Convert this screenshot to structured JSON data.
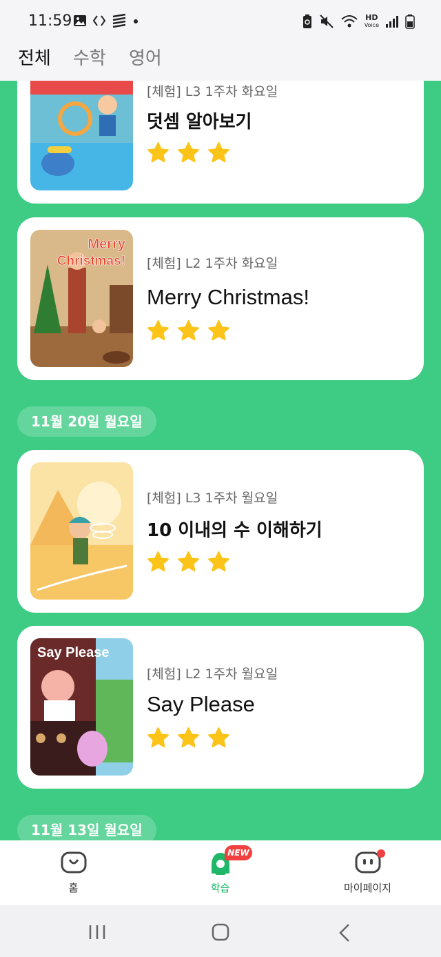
{
  "status_bar": {
    "time": "11:59",
    "hd_label": "HD",
    "voice_label": "Voice"
  },
  "top_tabs": [
    {
      "label": "전체",
      "active": true
    },
    {
      "label": "수학",
      "active": false
    },
    {
      "label": "영어",
      "active": false
    }
  ],
  "lessons": [
    {
      "meta": "[체험] L3 1주차 화요일",
      "title": "덧셈 알아보기",
      "stars": 3
    },
    {
      "meta": "[체험] L2 1주차 화요일",
      "title": "Merry Christmas!",
      "thumb_text": "Merry Christmas!",
      "stars": 3
    },
    {
      "meta": "[체험] L3 1주차 월요일",
      "title": "10 이내의 수 이해하기",
      "stars": 3
    },
    {
      "meta": "[체험] L2 1주차 월요일",
      "title": "Say Please",
      "thumb_text": "Say Please",
      "stars": 3
    }
  ],
  "date_headers": [
    "11월 20일 월요일",
    "11월 13일 월요일"
  ],
  "bottom_nav": [
    {
      "label": "홈",
      "icon": "home-face-icon",
      "active": false
    },
    {
      "label": "학습",
      "icon": "study-character-icon",
      "active": true,
      "badge": "NEW"
    },
    {
      "label": "마이페이지",
      "icon": "mypage-face-icon",
      "active": false,
      "dot": true
    }
  ],
  "colors": {
    "background": "#3ecc85",
    "star": "#fcc419",
    "accent": "#1fb868",
    "badge": "#f04040"
  }
}
